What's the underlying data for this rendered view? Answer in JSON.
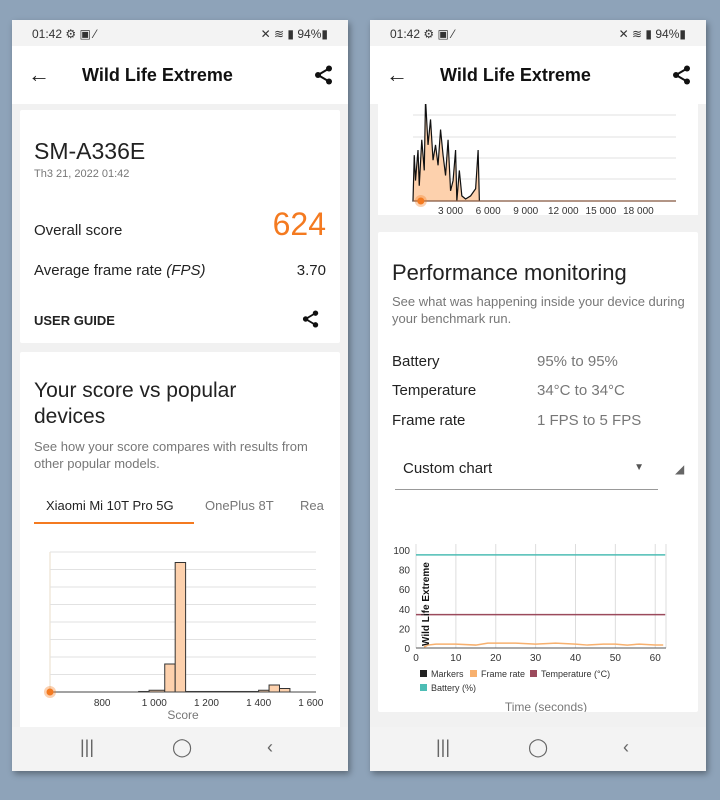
{
  "status_bar": {
    "time": "01:42",
    "icons": [
      "gear-icon",
      "image-icon",
      "wand-icon"
    ],
    "right_icons": [
      "mute-icon",
      "wifi-icon",
      "signal-icon"
    ],
    "battery": "94%"
  },
  "header": {
    "title": "Wild Life Extreme"
  },
  "left": {
    "device": {
      "name": "SM-A336E",
      "date": "Th3 21, 2022 01:42"
    },
    "overall_label": "Overall score",
    "overall_value": "624",
    "fps_label": "Average frame rate",
    "fps_unit": "(FPS)",
    "fps_value": "3.70",
    "user_guide": "USER GUIDE",
    "compare": {
      "title": "Your score vs popular devices",
      "subtitle": "See how your score compares with results from other popular models.",
      "tabs": [
        "Xiaomi Mi 10T Pro 5G",
        "OnePlus 8T",
        "Rea"
      ],
      "active_tab": 0
    }
  },
  "right": {
    "perf": {
      "title": "Performance monitoring",
      "subtitle": "See what was happening inside your device during your benchmark run.",
      "rows": [
        {
          "label": "Battery",
          "value": "95% to 95%"
        },
        {
          "label": "Temperature",
          "value": "34°C to 34°C"
        },
        {
          "label": "Frame rate",
          "value": "1 FPS to 5 FPS"
        }
      ],
      "dropdown": "Custom chart"
    }
  },
  "colors": {
    "accent": "#f47a20",
    "fill": "#fdd1ad",
    "battery": "#4dbdb5",
    "temperature": "#9b4a5c",
    "frame_rate": "#f7b06e"
  },
  "chart_data": [
    {
      "type": "bar",
      "title": "",
      "xlabel": "Score",
      "xlim": [
        600,
        1620
      ],
      "xticks": [
        "800",
        "1 000",
        "1 200",
        "1 400",
        "1 600"
      ],
      "tick_values": [
        800,
        1000,
        1200,
        1400,
        1600
      ],
      "bins": [
        [
          940,
          980,
          0.3
        ],
        [
          980,
          1040,
          1
        ],
        [
          1040,
          1080,
          16
        ],
        [
          1080,
          1120,
          74
        ],
        [
          1120,
          1400,
          0.3
        ],
        [
          1400,
          1440,
          1
        ],
        [
          1440,
          1480,
          4
        ],
        [
          1480,
          1520,
          2
        ]
      ],
      "ymax": 80,
      "grid": true,
      "marker_score": 624
    },
    {
      "type": "area",
      "xlabel": "Score",
      "xlim": [
        0,
        21000
      ],
      "xticks": [
        "3 000",
        "6 000",
        "9 000",
        "12 000",
        "15 000",
        "18 000"
      ],
      "tick_values": [
        3000,
        6000,
        9000,
        12000,
        15000,
        18000
      ],
      "x": [
        0,
        100,
        200,
        400,
        500,
        700,
        900,
        1000,
        1200,
        1400,
        1600,
        1800,
        2000,
        2200,
        2400,
        2600,
        2800,
        3000,
        3200,
        3400,
        3500,
        3700,
        3900,
        4200,
        4600,
        5000,
        5200,
        5300,
        5400,
        21000
      ],
      "y": [
        0,
        45,
        20,
        50,
        15,
        60,
        30,
        100,
        55,
        80,
        40,
        55,
        35,
        70,
        45,
        25,
        60,
        10,
        20,
        50,
        0,
        30,
        5,
        2,
        5,
        12,
        50,
        0,
        0,
        0
      ],
      "marker_score": 624
    },
    {
      "type": "line",
      "xlabel": "Time (seconds)",
      "xlim": [
        0,
        62.7
      ],
      "ylim": [
        0,
        100
      ],
      "xticks": [
        0,
        10,
        20,
        30,
        40,
        50,
        60
      ],
      "yticks": [
        0,
        20,
        40,
        60,
        80,
        100
      ],
      "annotation": "Wild Life Extreme",
      "legend": [
        "Markers",
        "Frame rate",
        "Temperature (°C)",
        "Battery (%)"
      ],
      "series": [
        {
          "name": "Battery (%)",
          "x": [
            0,
            62.5
          ],
          "y": [
            95,
            95
          ]
        },
        {
          "name": "Temperature (°C)",
          "x": [
            0,
            62.5
          ],
          "y": [
            34,
            34
          ]
        },
        {
          "name": "Frame rate",
          "x": [
            2,
            3,
            5,
            10,
            15,
            18,
            25,
            30,
            35,
            40,
            43,
            47,
            50,
            53,
            56,
            60,
            62
          ],
          "y": [
            1,
            3,
            4,
            4,
            3,
            5,
            5,
            4,
            5,
            4,
            3,
            4,
            4,
            3,
            4,
            3,
            3
          ]
        }
      ]
    }
  ]
}
